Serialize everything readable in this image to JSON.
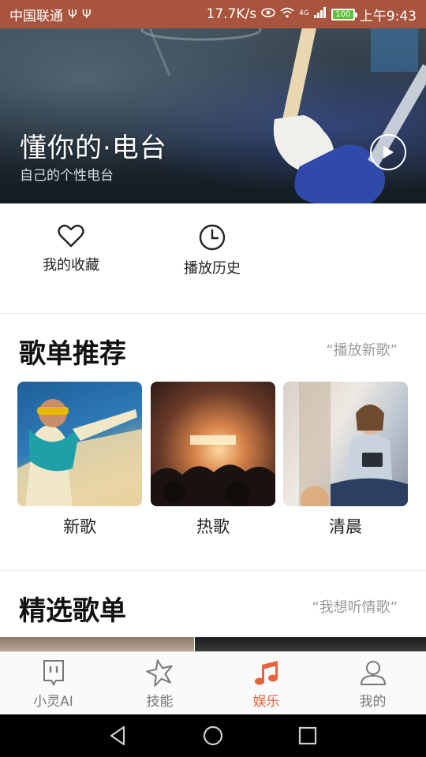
{
  "status_bar": {
    "carrier": "中国联通",
    "speed": "17.7K/s",
    "signal": "4G",
    "battery": "100",
    "time": "上午9:43"
  },
  "hero": {
    "title": "懂你的·电台",
    "subtitle": "自己的个性电台"
  },
  "quick_actions": [
    {
      "label": "我的收藏",
      "icon": "heart-icon"
    },
    {
      "label": "播放历史",
      "icon": "clock-icon"
    }
  ],
  "playlist_recommend": {
    "title": "歌单推荐",
    "link": "“播放新歌”",
    "cards": [
      {
        "label": "新歌"
      },
      {
        "label": "热歌"
      },
      {
        "label": "清晨"
      }
    ]
  },
  "featured_playlists": {
    "title": "精选歌单",
    "link": "“我想听情歌”"
  },
  "bottom_nav": {
    "active_color": "#e8623c",
    "items": [
      {
        "label": "小灵AI",
        "icon": "assistant-icon"
      },
      {
        "label": "技能",
        "icon": "star-icon"
      },
      {
        "label": "娱乐",
        "icon": "music-note-icon"
      },
      {
        "label": "我的",
        "icon": "person-icon"
      }
    ]
  }
}
